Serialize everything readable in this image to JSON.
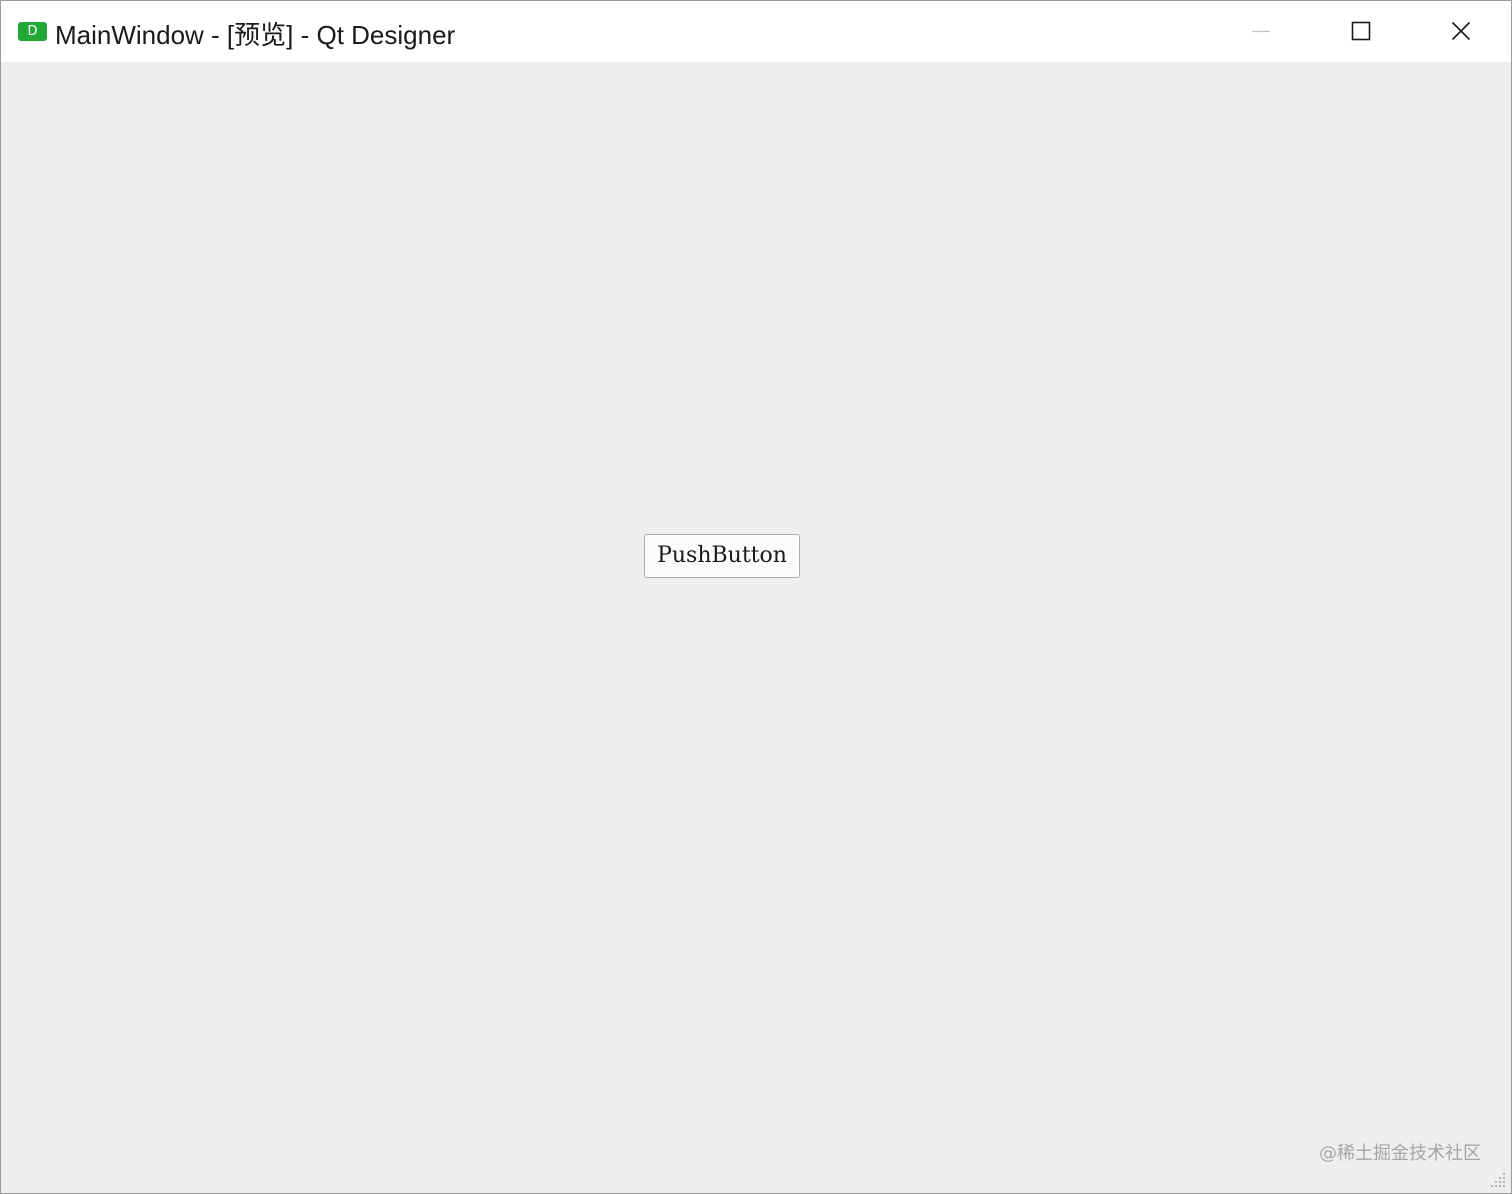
{
  "window": {
    "title": "MainWindow - [预览] - Qt Designer",
    "app_icon_letter": "D",
    "app_icon_color": "#22a837"
  },
  "titlebar_controls": {
    "minimize_icon": "minimize-icon",
    "maximize_icon": "maximize-icon",
    "close_icon": "close-icon"
  },
  "client": {
    "background_color": "#eeeeee",
    "push_button_label": "PushButton"
  },
  "watermark": {
    "text": "@稀土掘金技术社区"
  }
}
